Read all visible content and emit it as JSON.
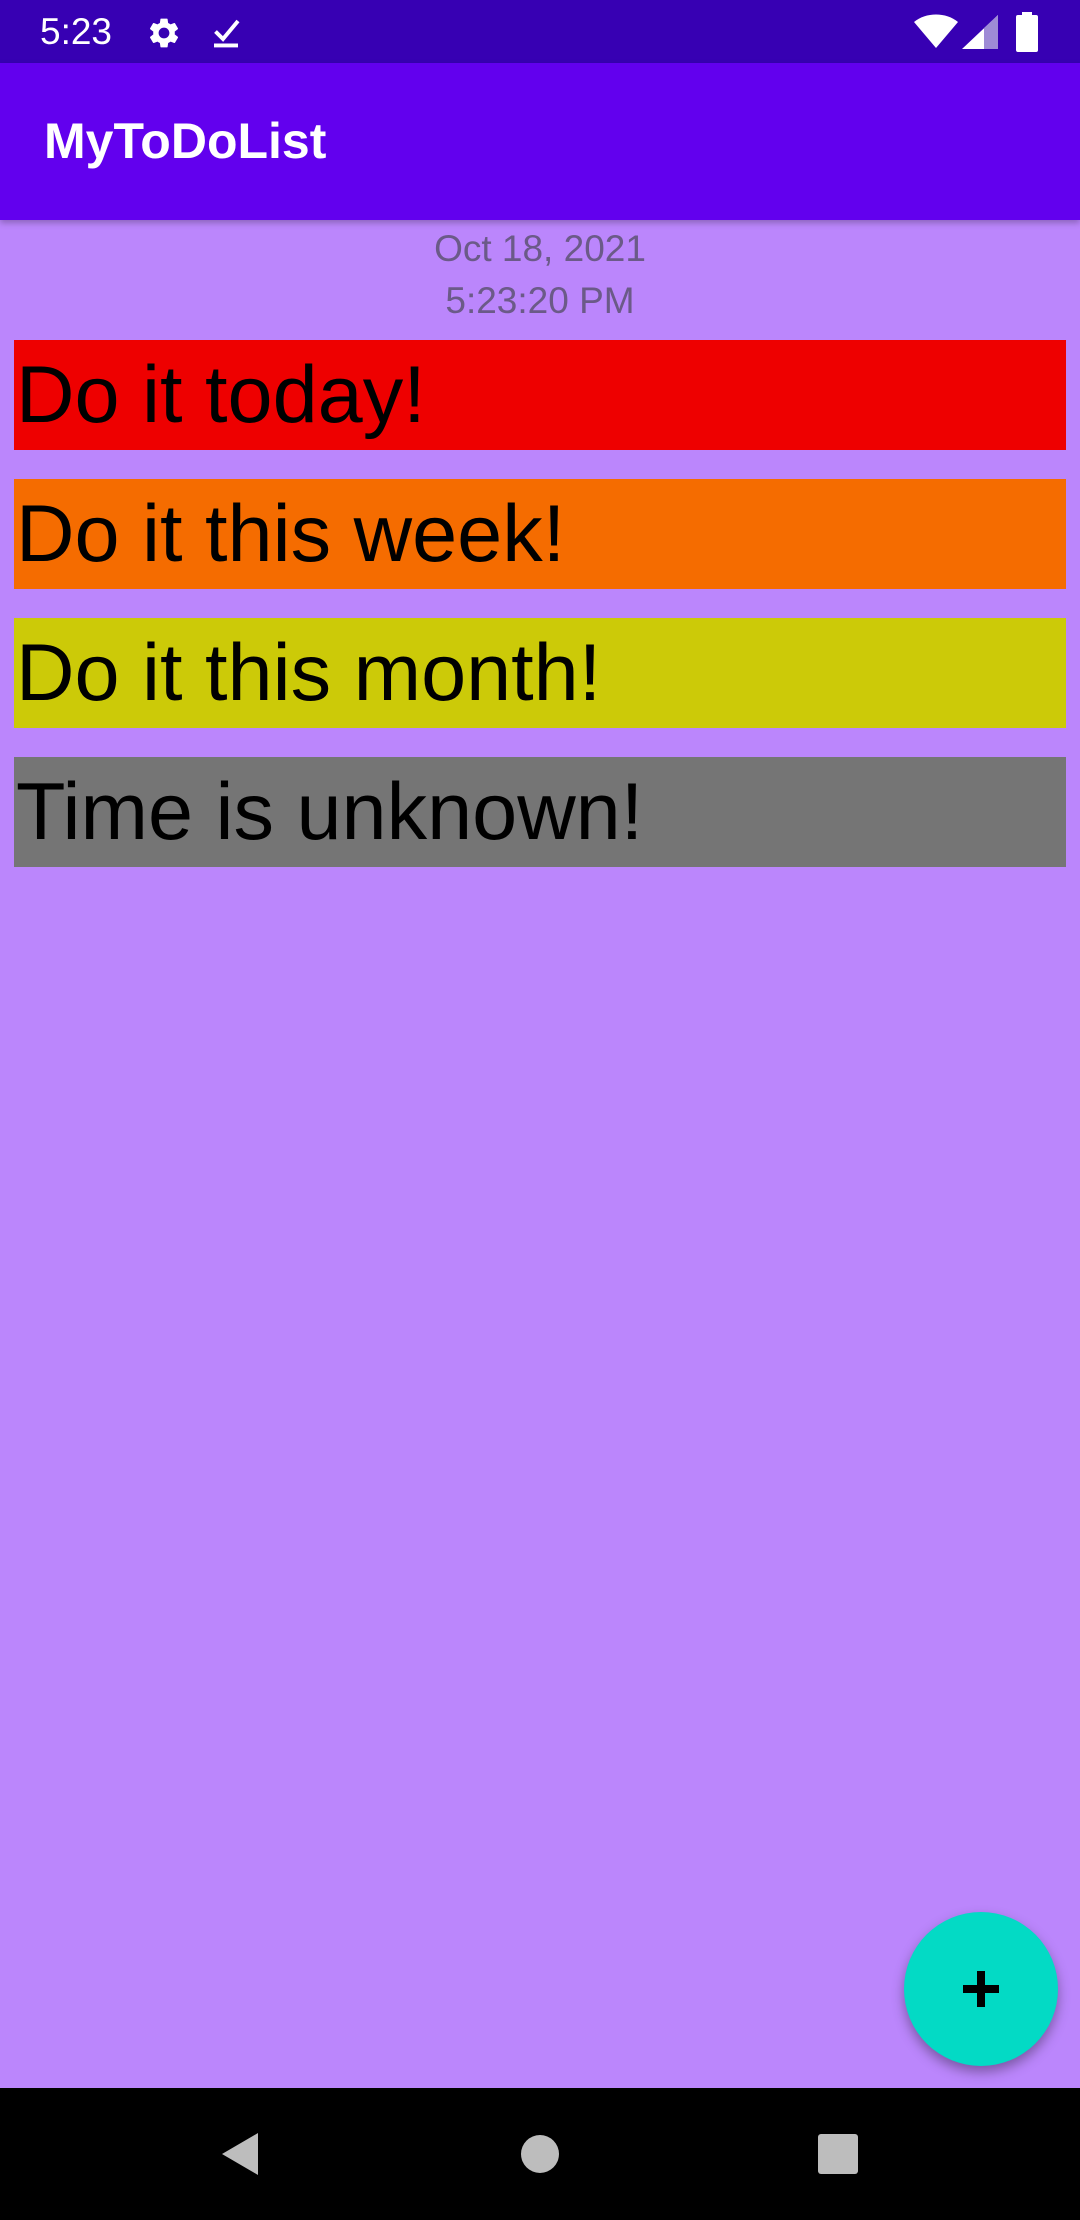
{
  "status_bar": {
    "time": "5:23",
    "icons": [
      "gear-icon",
      "download-check-icon",
      "wifi-icon",
      "cell-signal-icon",
      "battery-icon"
    ]
  },
  "app_bar": {
    "title": "MyToDoList"
  },
  "header": {
    "date": "Oct 18, 2021",
    "time": "5:23:20 PM"
  },
  "todo_items": [
    {
      "label": "Do it today!",
      "color": "#EE0000"
    },
    {
      "label": "Do it this week!",
      "color": "#F56C00"
    },
    {
      "label": "Do it this month!",
      "color": "#CCCA08"
    },
    {
      "label": "Time is unknown!",
      "color": "#757575"
    }
  ],
  "fab": {
    "icon": "plus-icon",
    "color": "#03DAC5"
  },
  "nav_bar": {
    "icons": [
      "back-icon",
      "home-icon",
      "recents-icon"
    ]
  },
  "colors": {
    "background": "#BB86FC",
    "app_bar": "#6200EE",
    "status_bar": "#3700B3"
  }
}
